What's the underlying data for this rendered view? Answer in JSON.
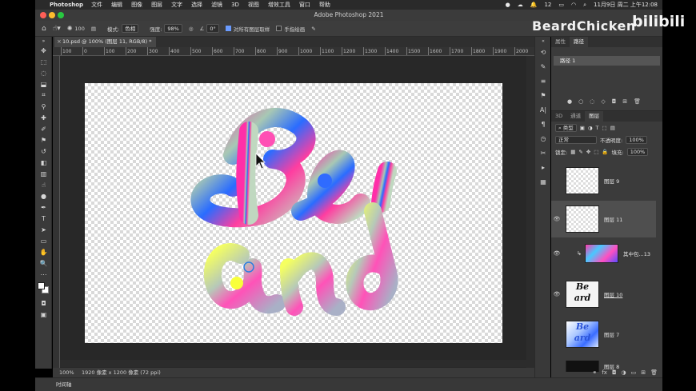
{
  "menubar": {
    "app_name": "Photoshop",
    "items": [
      "文件",
      "编辑",
      "图像",
      "图层",
      "文字",
      "选择",
      "滤镜",
      "3D",
      "视图",
      "增效工具",
      "窗口",
      "帮助"
    ],
    "wifi_count": "12",
    "datetime": "11月9日 周二 上午12:08"
  },
  "window": {
    "title": "Adobe Photoshop 2021"
  },
  "options": {
    "brush_size": "100",
    "mode_label": "模式:",
    "mode_value": "色相",
    "strength_label": "强度:",
    "strength_value": "98%",
    "angle_value": "0°",
    "sample_all_label": "对所有图层取样",
    "finger_paint_label": "手指绘画"
  },
  "watermark": {
    "text": "BeardChicken",
    "logo": "bilibili"
  },
  "document": {
    "tab_label": "10.psd @ 100% (图层 11, RGB/8) *",
    "zoom": "100%",
    "info": "1920 像素 x 1200 像素 (72 ppi)"
  },
  "ruler": {
    "ticks": [
      "100",
      "0",
      "100",
      "200",
      "300",
      "400",
      "500",
      "600",
      "700",
      "800",
      "900",
      "1000",
      "1100",
      "1200",
      "1300",
      "1400",
      "1500",
      "1600",
      "1700",
      "1800",
      "1900",
      "2000"
    ]
  },
  "timeline": {
    "label": "时间轴"
  },
  "paths_panel": {
    "tabs": [
      "属性",
      "路径"
    ],
    "active_tab": "路径",
    "paths": [
      "路径 1"
    ]
  },
  "layers_panel": {
    "tabs": [
      "3D",
      "通道",
      "图层"
    ],
    "active_tab": "图层",
    "filter_label": "类型",
    "blend_mode": "正常",
    "opacity_label": "不透明度:",
    "opacity_value": "100%",
    "lock_label": "锁定:",
    "fill_label": "填充:",
    "fill_value": "100%",
    "layers": [
      {
        "name": "图层 9"
      },
      {
        "name": "图层 11"
      },
      {
        "name": "其中包...13"
      },
      {
        "name": "图层 10"
      },
      {
        "name": "图层 7"
      },
      {
        "name": "图层 8"
      }
    ]
  },
  "colors": {
    "accent": "#6a9bff",
    "panel_bg": "#3b3b3b",
    "pasteboard": "#282828"
  }
}
